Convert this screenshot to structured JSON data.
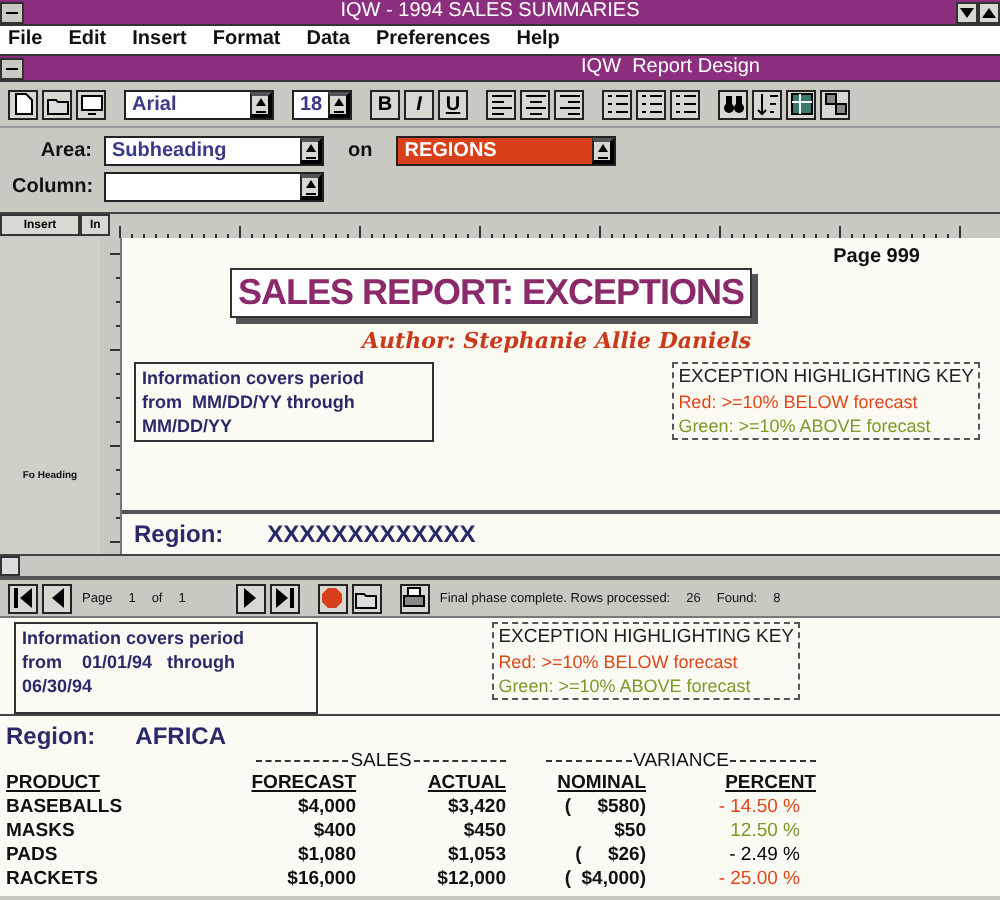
{
  "app_window": {
    "title": "IQW - 1994 SALES SUMMARIES"
  },
  "menu": [
    {
      "label": "File"
    },
    {
      "label": "Edit"
    },
    {
      "label": "Insert"
    },
    {
      "label": "Format"
    },
    {
      "label": "Data"
    },
    {
      "label": "Preferences"
    },
    {
      "label": "Help"
    }
  ],
  "design_window": {
    "title": "IQW  Report Design"
  },
  "toolbar": {
    "font": "Arial",
    "size": "18",
    "style_buttons": [
      {
        "label": "B",
        "kind": "bold"
      },
      {
        "label": "I",
        "kind": "italic"
      },
      {
        "label": "U",
        "kind": "underline"
      }
    ]
  },
  "area": {
    "label": "Area:",
    "value": "Subheading",
    "on_label": "on",
    "on_value": "REGIONS"
  },
  "column": {
    "label": "Column:"
  },
  "gutter": {
    "insert": "Insert",
    "unit": "In",
    "section": "Fo Heading"
  },
  "design": {
    "page": "Page 999",
    "title": "SALES REPORT: EXCEPTIONS",
    "author": "Author: Stephanie Allie Daniels",
    "period": [
      "Information covers period",
      "from  MM/DD/YY through",
      "MM/DD/YY"
    ],
    "key": {
      "title": "EXCEPTION HIGHLIGHTING KEY",
      "lines": [
        {
          "text": "Red: >=10% BELOW forecast",
          "color": "#e0461c"
        },
        {
          "text": "Green: >=10% ABOVE forecast",
          "color": "#7a9a2a"
        }
      ]
    },
    "region_label": "Region:",
    "region_value": "XXXXXXXXXXXXX"
  },
  "preview_bar": {
    "page_label": "Page",
    "page": "1",
    "of_label": "of",
    "pages": "1",
    "status": "Final phase complete. Rows processed:",
    "rows": "26",
    "found_label": "Found:",
    "found": "8"
  },
  "preview": {
    "period": [
      "Information covers period",
      "from    01/01/94   through",
      "06/30/94"
    ],
    "key": {
      "title": "EXCEPTION HIGHLIGHTING KEY",
      "lines": [
        {
          "text": "Red: >=10% BELOW forecast",
          "color": "#e0461c"
        },
        {
          "text": "Green: >=10% ABOVE forecast",
          "color": "#7a9a2a"
        }
      ]
    },
    "region_label": "Region:",
    "region_value": "AFRICA",
    "groups": [
      "SALES",
      "VARIANCE"
    ],
    "columns": [
      "PRODUCT",
      "FORECAST",
      "ACTUAL",
      "NOMINAL",
      "PERCENT"
    ],
    "rows": [
      {
        "product": "BASEBALLS",
        "forecast": "$4,000",
        "actual": "$3,420",
        "nominal": "(     $580)",
        "percent": "- 14.50 %",
        "color": "#e0461c"
      },
      {
        "product": "MASKS",
        "forecast": "$400",
        "actual": "$450",
        "nominal": "$50",
        "percent": "12.50 %",
        "color": "#7a9a2a"
      },
      {
        "product": "PADS",
        "forecast": "$1,080",
        "actual": "$1,053",
        "nominal": "(     $26)",
        "percent": "- 2.49 %",
        "color": "#000000"
      },
      {
        "product": "RACKETS",
        "forecast": "$16,000",
        "actual": "$12,000",
        "nominal": "(  $4,000)",
        "percent": "- 25.00 %",
        "color": "#e0461c"
      }
    ]
  }
}
